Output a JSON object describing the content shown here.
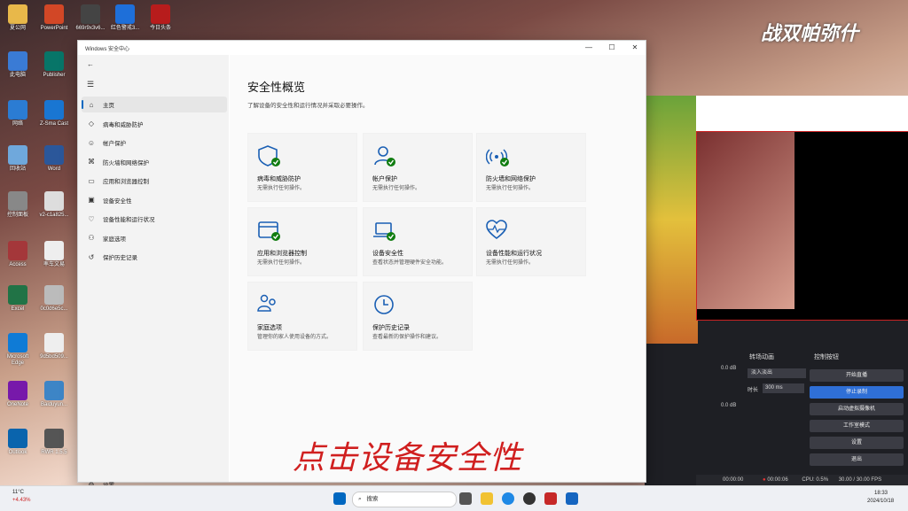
{
  "desktop": {
    "icons": [
      {
        "label": "夏公网"
      },
      {
        "label": "PowerPoint"
      },
      {
        "label": "669r9x3v6..."
      },
      {
        "label": "红色警戒3..."
      },
      {
        "label": "今日头条"
      },
      {
        "label": "此电脑"
      },
      {
        "label": "Publisher"
      },
      {
        "label": "网络"
      },
      {
        "label": "Z-Sma Cast"
      },
      {
        "label": "回收站"
      },
      {
        "label": "Word"
      },
      {
        "label": "控制面板"
      },
      {
        "label": "v2-c1a825..."
      },
      {
        "label": "Access"
      },
      {
        "label": "率车文易"
      },
      {
        "label": "Excel"
      },
      {
        "label": "0c0d6e5c..."
      },
      {
        "label": "Microsoft Edge"
      },
      {
        "label": "9d5bd509..."
      },
      {
        "label": "OneNote"
      },
      {
        "label": "Baiduyun..."
      },
      {
        "label": "Outlook"
      },
      {
        "label": "RWR 1.5.5"
      }
    ],
    "banner": "战双帕弥什",
    "caption": "点击设备安全性"
  },
  "window": {
    "title": "Windows 安全中心",
    "minimize": "—",
    "maximize": "☐",
    "close": "✕"
  },
  "sidebar": {
    "back": "←",
    "menu": "☰",
    "items": [
      {
        "label": "主页",
        "icon": "⌂",
        "active": true
      },
      {
        "label": "病毒和威胁防护",
        "icon": "◇"
      },
      {
        "label": "帐户保护",
        "icon": "☺"
      },
      {
        "label": "防火墙和网络保护",
        "icon": "⌘"
      },
      {
        "label": "应用和浏览器控制",
        "icon": "▭"
      },
      {
        "label": "设备安全性",
        "icon": "▣"
      },
      {
        "label": "设备性能和运行状况",
        "icon": "♡"
      },
      {
        "label": "家庭选项",
        "icon": "⚇"
      },
      {
        "label": "保护历史记录",
        "icon": "↺"
      }
    ],
    "settings": {
      "label": "设置",
      "icon": "⚙"
    }
  },
  "main": {
    "title": "安全性概览",
    "subtitle": "了解设备的安全性和运行情况并采取必要操作。",
    "cards": [
      {
        "title": "病毒和威胁防护",
        "desc": "无需执行任何操作。",
        "icon": "shield-icon"
      },
      {
        "title": "帐户保护",
        "desc": "无需执行任何操作。",
        "icon": "person-icon"
      },
      {
        "title": "防火墙和网络保护",
        "desc": "无需执行任何操作。",
        "icon": "wifi-icon"
      },
      {
        "title": "应用和浏览器控制",
        "desc": "无需执行任何操作。",
        "icon": "browser-icon"
      },
      {
        "title": "设备安全性",
        "desc": "查看状态并管理硬件安全功能。",
        "icon": "laptop-icon"
      },
      {
        "title": "设备性能和运行状况",
        "desc": "无需执行任何操作。",
        "icon": "heart-icon"
      },
      {
        "title": "家庭选项",
        "desc": "管理你的家人使用设备的方式。",
        "icon": "family-icon"
      },
      {
        "title": "保护历史记录",
        "desc": "查看最新的保护操作和建议。",
        "icon": "history-icon"
      }
    ]
  },
  "obs": {
    "panels": {
      "transitions": "转场动画",
      "controls": "控制按钮"
    },
    "transition_select": "淡入淡出",
    "duration_label": "时长",
    "duration_value": "300 ms",
    "db_values": [
      "0.0 dB",
      "0.0 dB"
    ],
    "controls": [
      {
        "label": "开始直播",
        "on": false
      },
      {
        "label": "停止录制",
        "on": true
      },
      {
        "label": "启动虚拟摄像机",
        "on": false
      },
      {
        "label": "工作室模式",
        "on": false
      },
      {
        "label": "设置",
        "on": false
      },
      {
        "label": "退出",
        "on": false
      }
    ],
    "status": {
      "t1": "00:00:00",
      "t2": "00:00:06",
      "cpu": "CPU: 0.5%",
      "fps": "30.00 / 30.00 FPS"
    }
  },
  "taskbar": {
    "weather": "11°C",
    "stock": "+4.43%",
    "search": "搜索",
    "time": "18:33",
    "date": "2024/10/18"
  },
  "colors": {
    "accent": "#0067c0",
    "check": "#107c10",
    "record_red": "#d01f1f"
  }
}
